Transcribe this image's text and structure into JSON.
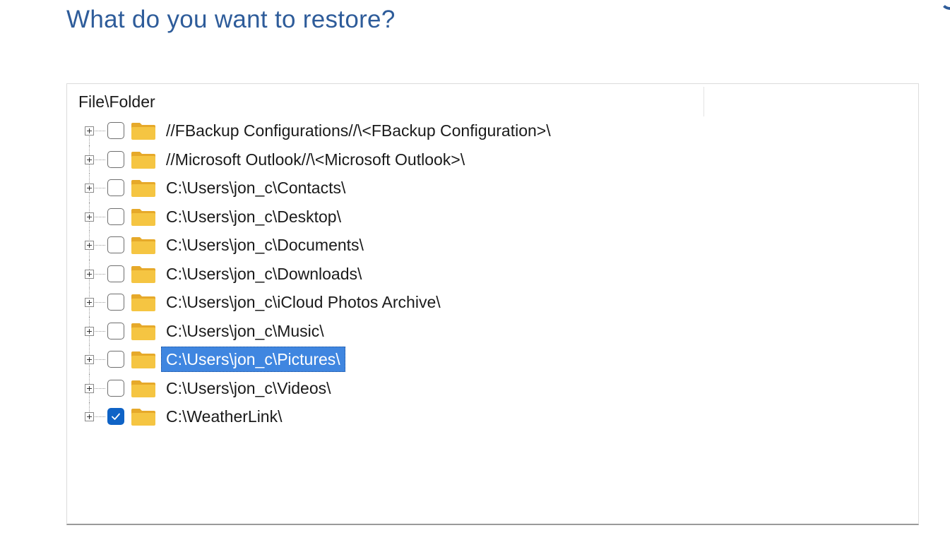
{
  "page": {
    "title": "What do you want to restore?"
  },
  "tree": {
    "column_header": "File\\Folder",
    "items": [
      {
        "label": "//FBackup Configurations//\\<FBackup Configuration>\\",
        "checked": false,
        "selected": false
      },
      {
        "label": "//Microsoft Outlook//\\<Microsoft Outlook>\\",
        "checked": false,
        "selected": false
      },
      {
        "label": "C:\\Users\\jon_c\\Contacts\\",
        "checked": false,
        "selected": false
      },
      {
        "label": "C:\\Users\\jon_c\\Desktop\\",
        "checked": false,
        "selected": false
      },
      {
        "label": "C:\\Users\\jon_c\\Documents\\",
        "checked": false,
        "selected": false
      },
      {
        "label": "C:\\Users\\jon_c\\Downloads\\",
        "checked": false,
        "selected": false
      },
      {
        "label": "C:\\Users\\jon_c\\iCloud Photos Archive\\",
        "checked": false,
        "selected": false
      },
      {
        "label": "C:\\Users\\jon_c\\Music\\",
        "checked": false,
        "selected": false
      },
      {
        "label": "C:\\Users\\jon_c\\Pictures\\",
        "checked": false,
        "selected": true
      },
      {
        "label": "C:\\Users\\jon_c\\Videos\\",
        "checked": false,
        "selected": false
      },
      {
        "label": "C:\\WeatherLink\\",
        "checked": true,
        "selected": false
      }
    ]
  },
  "icons": {
    "expander": "plus-box-icon",
    "folder": "folder-icon",
    "check": "checkmark-icon"
  },
  "colors": {
    "title": "#2e5c9a",
    "selection": "#3f86e0",
    "checkbox_checked": "#0f63c6",
    "folder": "#f5c542"
  }
}
